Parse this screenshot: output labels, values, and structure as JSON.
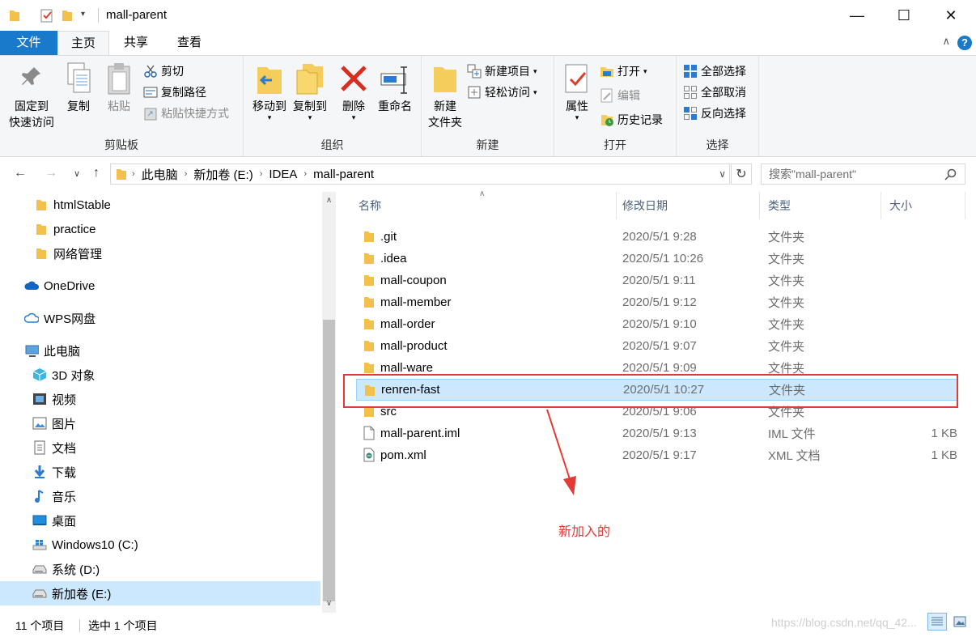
{
  "window": {
    "title": "mall-parent",
    "minimize": "—",
    "maximize": "☐",
    "close": "✕"
  },
  "tabs": [
    {
      "label": "文件"
    },
    {
      "label": "主页"
    },
    {
      "label": "共享"
    },
    {
      "label": "查看"
    }
  ],
  "ribbon": {
    "clipboard": {
      "label": "剪贴板",
      "pin": "固定到\n快速访问",
      "pin_l1": "固定到",
      "pin_l2": "快速访问",
      "copy": "复制",
      "paste": "粘贴",
      "cut": "剪切",
      "copy_path": "复制路径",
      "paste_shortcut": "粘贴快捷方式"
    },
    "organize": {
      "label": "组织",
      "move_to": "移动到",
      "copy_to": "复制到",
      "delete": "删除",
      "rename": "重命名"
    },
    "new": {
      "label": "新建",
      "new_folder_l1": "新建",
      "new_folder_l2": "文件夹",
      "new_item": "新建项目",
      "easy_access": "轻松访问"
    },
    "open": {
      "label": "打开",
      "properties": "属性",
      "open": "打开",
      "edit": "编辑",
      "history": "历史记录"
    },
    "select": {
      "label": "选择",
      "select_all": "全部选择",
      "select_none": "全部取消",
      "invert": "反向选择"
    }
  },
  "address": {
    "crumbs": [
      "此电脑",
      "新加卷 (E:)",
      "IDEA",
      "mall-parent"
    ],
    "search_placeholder": "搜索\"mall-parent\""
  },
  "navpane": [
    {
      "label": "htmlStable",
      "icon": "folder-icon"
    },
    {
      "label": "practice",
      "icon": "folder-icon"
    },
    {
      "label": "网络管理",
      "icon": "folder-icon"
    },
    {
      "label": "OneDrive",
      "icon": "onedrive-icon"
    },
    {
      "label": "WPS网盘",
      "icon": "cloud-icon"
    },
    {
      "label": "此电脑",
      "icon": "pc-icon"
    },
    {
      "label": "3D 对象",
      "icon": "3d-objects-icon"
    },
    {
      "label": "视频",
      "icon": "video-icon"
    },
    {
      "label": "图片",
      "icon": "pictures-icon"
    },
    {
      "label": "文档",
      "icon": "documents-icon"
    },
    {
      "label": "下载",
      "icon": "download-icon"
    },
    {
      "label": "音乐",
      "icon": "music-icon"
    },
    {
      "label": "桌面",
      "icon": "desktop-icon"
    },
    {
      "label": "Windows10 (C:)",
      "icon": "drive-icon"
    },
    {
      "label": "系统 (D:)",
      "icon": "drive-icon"
    },
    {
      "label": "新加卷 (E:)",
      "icon": "drive-icon"
    }
  ],
  "columns": {
    "name": "名称",
    "date": "修改日期",
    "type": "类型",
    "size": "大小"
  },
  "files": [
    {
      "name": ".git",
      "date": "2020/5/1 9:28",
      "type": "文件夹",
      "size": "",
      "icon": "folder-icon"
    },
    {
      "name": ".idea",
      "date": "2020/5/1 10:26",
      "type": "文件夹",
      "size": "",
      "icon": "folder-icon"
    },
    {
      "name": "mall-coupon",
      "date": "2020/5/1 9:11",
      "type": "文件夹",
      "size": "",
      "icon": "folder-icon"
    },
    {
      "name": "mall-member",
      "date": "2020/5/1 9:12",
      "type": "文件夹",
      "size": "",
      "icon": "folder-icon"
    },
    {
      "name": "mall-order",
      "date": "2020/5/1 9:10",
      "type": "文件夹",
      "size": "",
      "icon": "folder-icon"
    },
    {
      "name": "mall-product",
      "date": "2020/5/1 9:07",
      "type": "文件夹",
      "size": "",
      "icon": "folder-icon"
    },
    {
      "name": "mall-ware",
      "date": "2020/5/1 9:09",
      "type": "文件夹",
      "size": "",
      "icon": "folder-icon"
    },
    {
      "name": "renren-fast",
      "date": "2020/5/1 10:27",
      "type": "文件夹",
      "size": "",
      "icon": "folder-icon"
    },
    {
      "name": "src",
      "date": "2020/5/1 9:06",
      "type": "文件夹",
      "size": "",
      "icon": "folder-icon"
    },
    {
      "name": "mall-parent.iml",
      "date": "2020/5/1 9:13",
      "type": "IML 文件",
      "size": "1 KB",
      "icon": "file-icon"
    },
    {
      "name": "pom.xml",
      "date": "2020/5/1 9:17",
      "type": "XML 文档",
      "size": "1 KB",
      "icon": "xml-file-icon"
    }
  ],
  "annotation": {
    "text": "新加入的",
    "color": "#e53935"
  },
  "status": {
    "count": "11 个项目",
    "selected": "选中 1 个项目"
  },
  "watermark": "https://blog.csdn.net/qq_42..."
}
